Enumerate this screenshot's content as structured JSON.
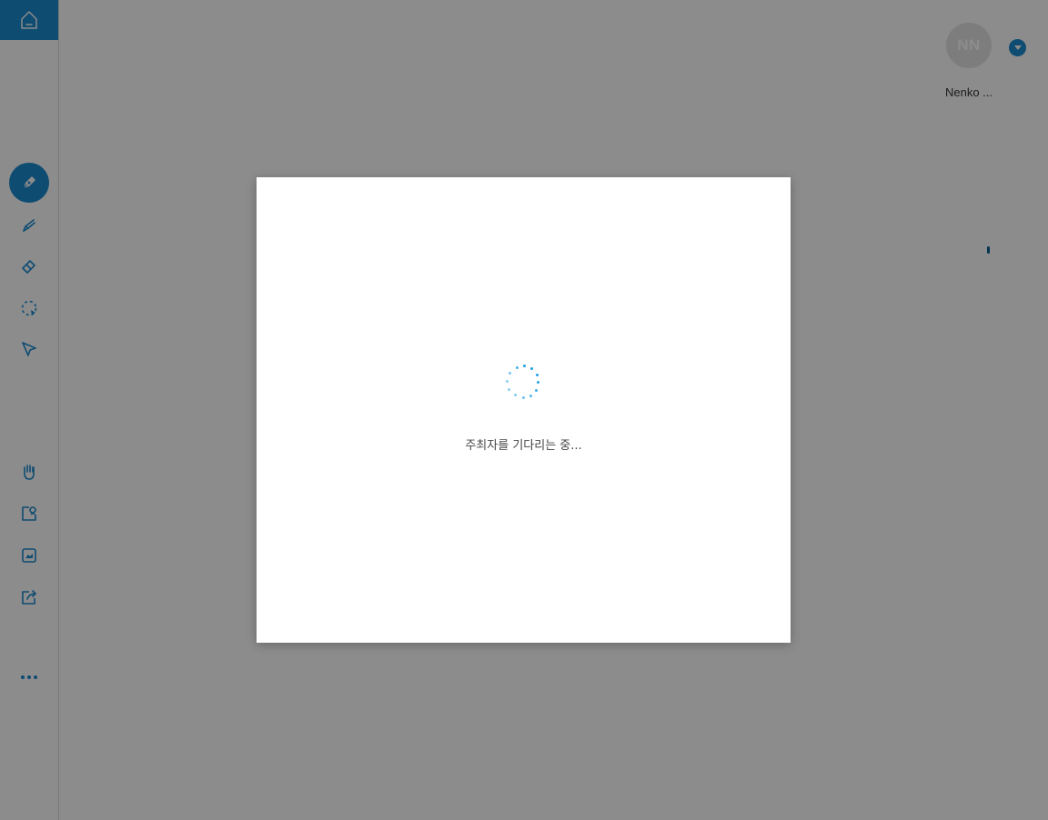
{
  "sidebar": {
    "home_icon": "home-icon",
    "tools": [
      {
        "name": "pen-tool",
        "icon": "pen-icon",
        "active": true
      },
      {
        "name": "highlighter-tool",
        "icon": "highlighter-icon",
        "active": false
      },
      {
        "name": "eraser-tool",
        "icon": "eraser-icon",
        "active": false
      },
      {
        "name": "lasso-tool",
        "icon": "lasso-icon",
        "active": false
      },
      {
        "name": "pointer-tool",
        "icon": "pointer-icon",
        "active": false
      },
      {
        "name": "hand-tool",
        "icon": "hand-icon",
        "active": false
      },
      {
        "name": "camera-tool",
        "icon": "camera-icon",
        "active": false
      },
      {
        "name": "image-tool",
        "icon": "image-icon",
        "active": false
      },
      {
        "name": "share-tool",
        "icon": "share-icon",
        "active": false
      },
      {
        "name": "more-tool",
        "icon": "more-icon",
        "active": false
      }
    ]
  },
  "user": {
    "initials": "NN",
    "name": "Nenko ..."
  },
  "modal": {
    "status_text": "주최자를 기다리는 중..."
  },
  "colors": {
    "accent": "#1a8bd0",
    "spinner": "#1ea0e6",
    "overlay": "rgba(0,0,0,0.45)"
  }
}
